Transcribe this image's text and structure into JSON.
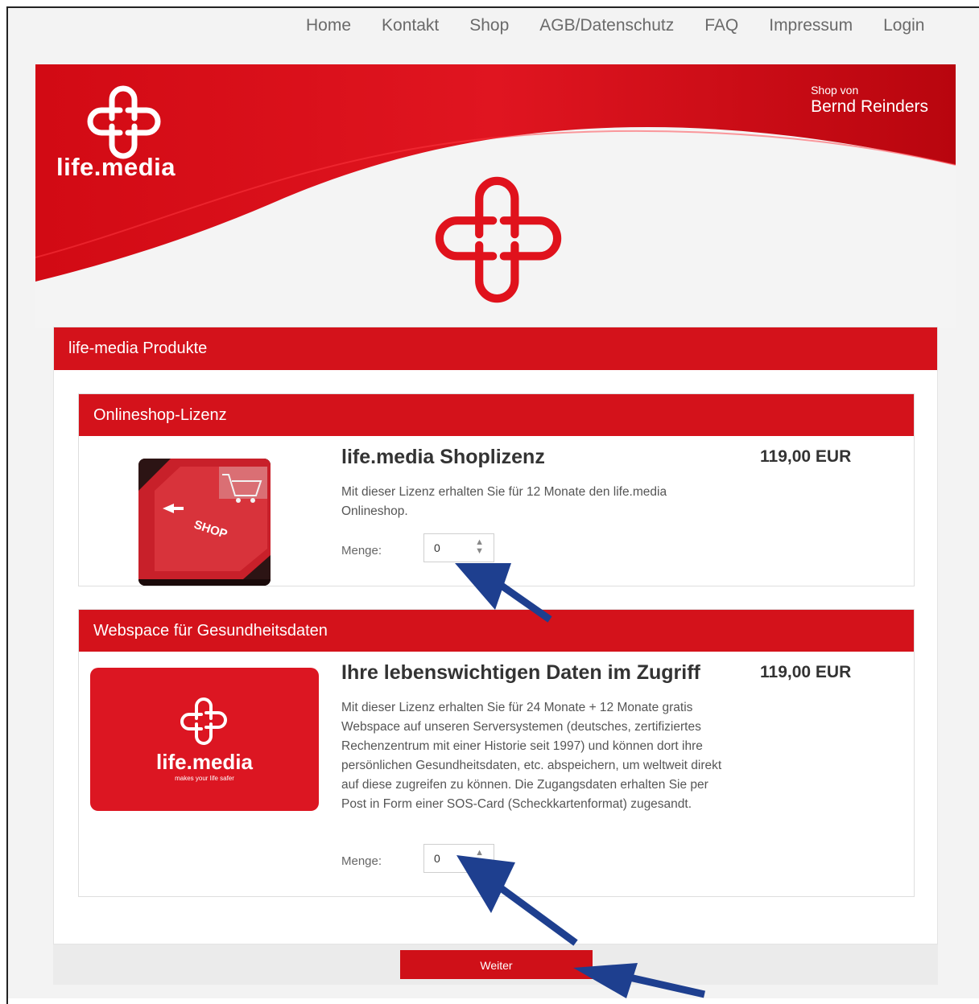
{
  "nav": {
    "items": [
      "Home",
      "Kontakt",
      "Shop",
      "AGB/Datenschutz",
      "FAQ",
      "Impressum",
      "Login"
    ]
  },
  "banner": {
    "logo_text": "life.media",
    "shop_by_small": "Shop von",
    "shop_by_name": "Bernd Reinders"
  },
  "panel": {
    "title": "life-media Produkte"
  },
  "products": [
    {
      "category": "Onlineshop-Lizenz",
      "title": "life.media Shoplizenz",
      "price": "119,00 EUR",
      "description": "Mit dieser Lizenz erhalten Sie für 12 Monate den life.media Onlineshop.",
      "qty_label": "Menge:",
      "qty_value": "0",
      "image_icon": "shop-keyboard-key-image",
      "image_key_text": "SHOP"
    },
    {
      "category": "Webspace für Gesundheitsdaten",
      "title": "Ihre lebenswichtigen Daten im Zugriff",
      "price": "119,00 EUR",
      "description": "Mit dieser Lizenz erhalten Sie für 24 Monate + 12 Monate gratis Webspace auf unseren Serversystemen (deutsches, zertifiziertes Rechenzentrum mit einer Historie seit 1997) und können dort ihre persönlichen Gesundheitsdaten, etc. abspeichern, um weltweit direkt auf diese zugreifen zu können. Die Zugangsdaten erhalten Sie per Post in Form einer SOS-Card (Scheckkartenformat) zugesandt.",
      "qty_label": "Menge:",
      "qty_value": "0",
      "image_logo_text": "life.media",
      "image_tagline": "makes your life safer"
    }
  ],
  "footer": {
    "weiter_label": "Weiter"
  },
  "colors": {
    "brand_red": "#d4121b",
    "annotation_arrow": "#1e3f8f"
  }
}
